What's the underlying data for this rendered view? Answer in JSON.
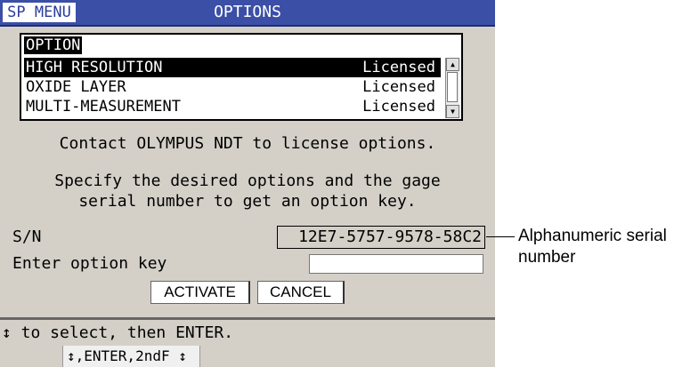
{
  "header": {
    "menu_label": "SP MENU",
    "title": "OPTIONS"
  },
  "options": {
    "column_header": "OPTION",
    "rows": [
      {
        "name": "HIGH RESOLUTION",
        "status": "Licensed",
        "selected": true
      },
      {
        "name": "OXIDE LAYER",
        "status": "Licensed",
        "selected": false
      },
      {
        "name": "MULTI-MEASUREMENT",
        "status": "Licensed",
        "selected": false
      }
    ]
  },
  "messages": {
    "contact": "Contact OLYMPUS NDT to license options.",
    "specify_line1": "Specify the desired options and the gage",
    "specify_line2": "serial number to get an option key."
  },
  "serial": {
    "label": "S/N",
    "value": "12E7-5757-9578-58C2"
  },
  "option_key": {
    "label": "Enter option key",
    "value": ""
  },
  "buttons": {
    "activate": "ACTIVATE",
    "cancel": "CANCEL"
  },
  "footer": {
    "hint": "↕ to select, then ENTER.",
    "keys": "↕,ENTER,2ndF ↕"
  },
  "callout": {
    "text": "Alphanumeric serial number"
  },
  "colors": {
    "titlebar": "#3b4fa6",
    "screen_bg": "#d4d0c8",
    "selection": "#000000"
  }
}
